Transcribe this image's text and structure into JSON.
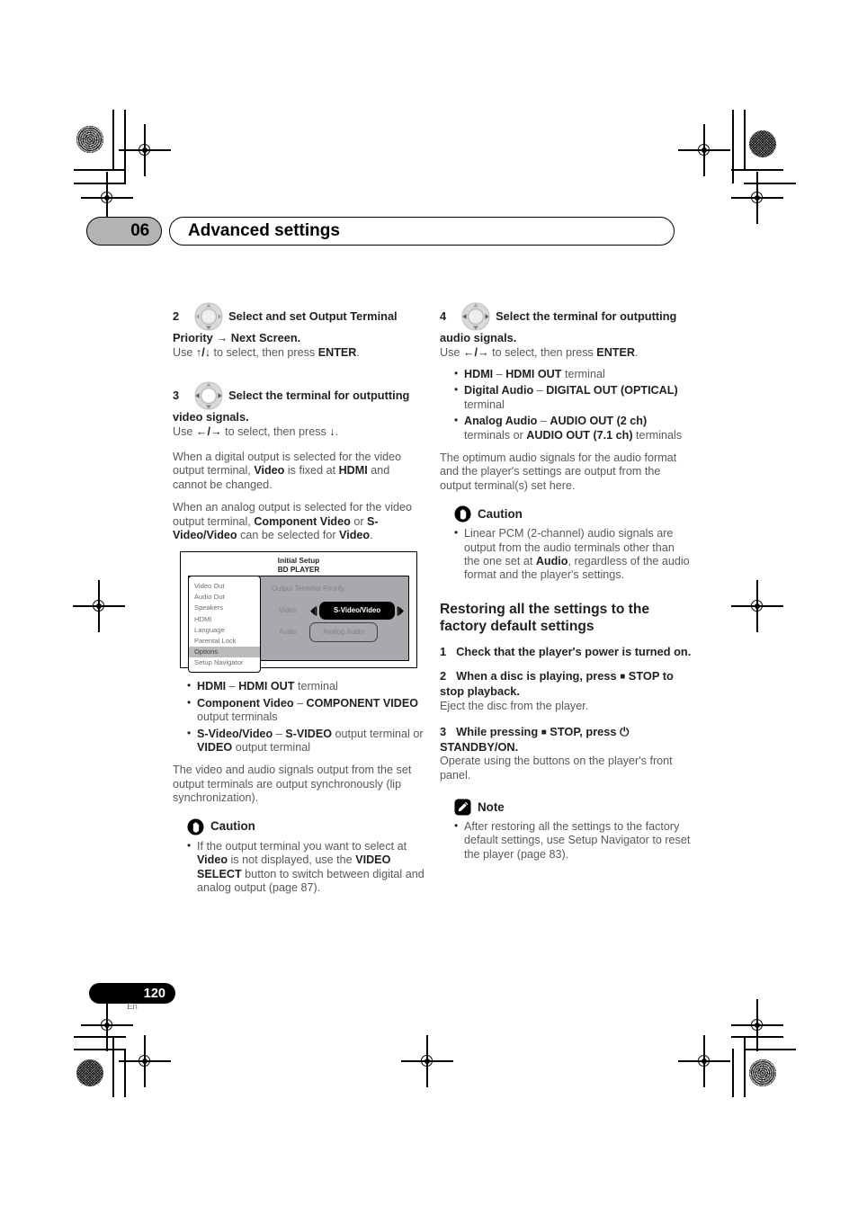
{
  "header": {
    "chapter_number": "06",
    "chapter_title": "Advanced settings"
  },
  "footer": {
    "page_number": "120",
    "language_code": "En"
  },
  "left_column": {
    "step2": {
      "number": "2",
      "icon": "cursor-wheel-icon",
      "heading": "Select and set Output Terminal Priority → Next Screen.",
      "body_prefix": "Use ",
      "body_keys": "↑/↓",
      "body_mid": " to select, then press ",
      "body_bold": "ENTER",
      "body_suffix": "."
    },
    "step3": {
      "number": "3",
      "icon": "cursor-wheel-icon",
      "heading": "Select the terminal for outputting video signals.",
      "body_prefix": "Use ",
      "body_keys": "←/→",
      "body_mid": " to select, then press ",
      "body_key_end": "↓",
      "body_suffix": "."
    },
    "para_digital": {
      "t1": "When a digital output is selected for the video output terminal, ",
      "b1": "Video",
      "t2": " is fixed at ",
      "b2": "HDMI",
      "t3": " and cannot be changed."
    },
    "para_analog": {
      "t1": "When an analog output is selected for the video output terminal, ",
      "b1": "Component Video",
      "t2": " or ",
      "b2": "S-Video/Video",
      "t3": " can be selected for ",
      "b3": "Video",
      "t4": "."
    },
    "osd": {
      "title_line1": "Initial Setup",
      "title_line2": "BD PLAYER",
      "section_label": "Output Terminal Priority",
      "menu_items": [
        {
          "label": "Video Out",
          "selected": false
        },
        {
          "label": "Audio Out",
          "selected": false
        },
        {
          "label": "Speakers",
          "selected": false
        },
        {
          "label": "HDMI",
          "selected": false
        },
        {
          "label": "Language",
          "selected": false
        },
        {
          "label": "Parental Lock",
          "selected": false
        },
        {
          "label": "Options",
          "selected": true
        },
        {
          "label": "Setup Navigator",
          "selected": false
        }
      ],
      "rows": [
        {
          "label": "Video",
          "value": "S-Video/Video",
          "style": "filled",
          "arrows": true
        },
        {
          "label": "Audio",
          "value": "Analog Audio",
          "style": "outline",
          "arrows": false
        }
      ]
    },
    "bullets": [
      {
        "b1": "HDMI",
        "t1": " – ",
        "b2": "HDMI OUT",
        "t2": " terminal"
      },
      {
        "b1": "Component Video",
        "t1": " – ",
        "b2": "COMPONENT VIDEO",
        "t2": " output terminals"
      },
      {
        "b1": "S-Video/Video",
        "t1": " – ",
        "b2": "S-VIDEO",
        "t2": " output terminal or ",
        "b3": "VIDEO",
        "t3": " output terminal"
      }
    ],
    "para_sync": "The video and audio signals output from the set output terminals are output synchronously (lip synchronization).",
    "caution": {
      "icon": "caution-hand-icon",
      "label": "Caution",
      "t1": "If the output terminal you want to select at ",
      "b1": "Video",
      "t2": " is not displayed, use the ",
      "b2": "VIDEO SELECT",
      "t3": " button to switch between digital and analog output (page 87)."
    }
  },
  "right_column": {
    "step4": {
      "number": "4",
      "icon": "cursor-wheel-icon",
      "heading": "Select the terminal for outputting audio signals.",
      "body_prefix": "Use ",
      "body_keys": "←/→",
      "body_mid": " to select, then press ",
      "body_bold": "ENTER",
      "body_suffix": "."
    },
    "bullets": [
      {
        "b1": "HDMI",
        "t1": " – ",
        "b2": "HDMI OUT",
        "t2": " terminal"
      },
      {
        "b1": "Digital Audio",
        "t1": " – ",
        "b2": "DIGITAL OUT (OPTICAL)",
        "t2": " terminal"
      },
      {
        "b1": "Analog Audio",
        "t1": " – ",
        "b2": "AUDIO OUT (2 ch)",
        "t2": " terminals or ",
        "b3": "AUDIO OUT (7.1 ch)",
        "t3": " terminals"
      }
    ],
    "para_optimum": "The optimum audio signals for the audio format and the player's settings are output from the output terminal(s) set here.",
    "caution": {
      "icon": "caution-hand-icon",
      "label": "Caution",
      "t1": "Linear PCM (2-channel) audio signals are output from the audio terminals other than the one set at ",
      "b1": "Audio",
      "t2": ", regardless of the audio format and the player's settings."
    },
    "section_heading": "Restoring all the settings to the factory default settings",
    "step1": {
      "number": "1",
      "heading": "Check that the player's power is turned on."
    },
    "step2": {
      "number": "2",
      "heading_pre": "When a disc is playing, press ",
      "heading_sym": "■",
      "heading_post": " STOP to stop playback.",
      "body": "Eject the disc from the player."
    },
    "step3": {
      "number": "3",
      "heading_pre": "While pressing ",
      "heading_sym": "■",
      "heading_mid": " STOP, press ",
      "heading_power": "⏻",
      "heading_post": " STANDBY/ON.",
      "body": "Operate using the buttons on the player's front panel."
    },
    "note": {
      "icon": "note-pencil-icon",
      "label": "Note",
      "text": "After restoring all the settings to the factory default settings, use Setup Navigator to reset the player (page 83)."
    }
  }
}
